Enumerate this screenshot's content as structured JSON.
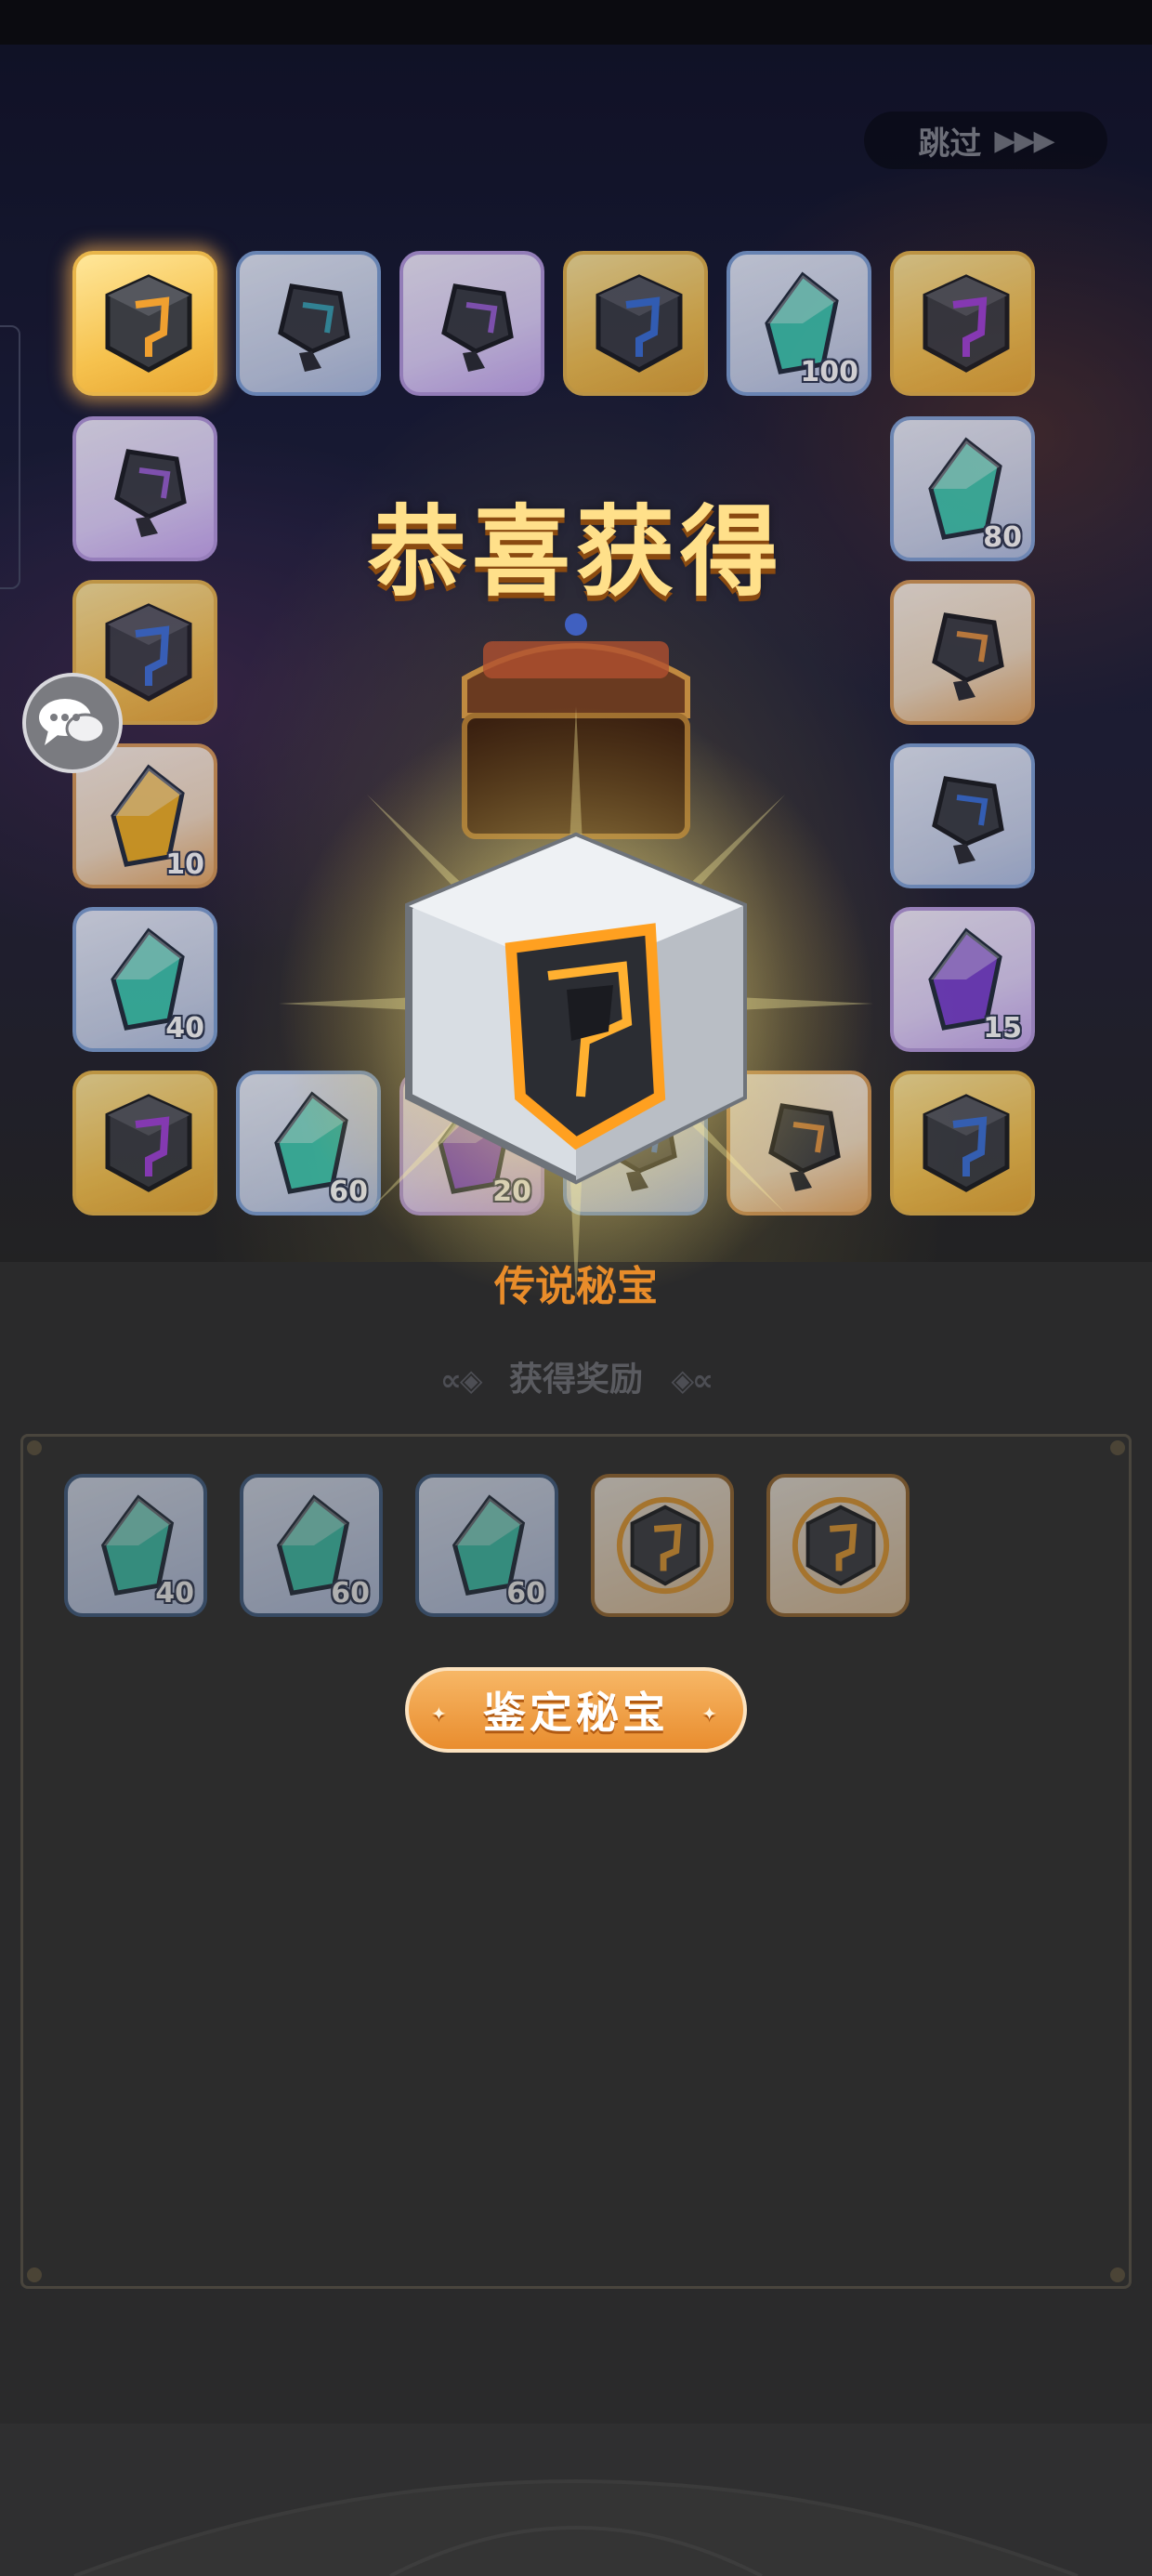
{
  "skip": {
    "label": "跳过",
    "arrows": "▶▶▶"
  },
  "headline": "恭喜获得",
  "obtained_item": {
    "name": "传说秘宝",
    "icon": "legendary-cube-icon"
  },
  "reward_header": {
    "label": "获得奖励",
    "deco_left": "∝◈",
    "deco_right": "◈∝"
  },
  "board": {
    "tiles": [
      {
        "kind": "cube",
        "rarity": "gold",
        "accent": "#f0a030",
        "qty": ""
      },
      {
        "kind": "cube-small",
        "rarity": "blue",
        "accent": "#3aa0b0",
        "qty": ""
      },
      {
        "kind": "cube-small",
        "rarity": "purple",
        "accent": "#9a60d0",
        "qty": ""
      },
      {
        "kind": "cube",
        "rarity": "gold",
        "accent": "#3a70d8",
        "qty": ""
      },
      {
        "kind": "crystal",
        "rarity": "blue",
        "accent": "#3cc8b0",
        "qty": "100"
      },
      {
        "kind": "cube",
        "rarity": "gold",
        "accent": "#a040d8",
        "qty": ""
      },
      {
        "kind": "cube-small",
        "rarity": "purple",
        "accent": "#9a60d0",
        "qty": ""
      },
      {
        "kind": "crystal",
        "rarity": "blue",
        "accent": "#3cc8b0",
        "qty": "80"
      },
      {
        "kind": "cube",
        "rarity": "gold",
        "accent": "#3a70d8",
        "qty": ""
      },
      {
        "kind": "cube-small",
        "rarity": "orange",
        "accent": "#e09040",
        "qty": ""
      },
      {
        "kind": "crystal",
        "rarity": "orange",
        "accent": "#f0b020",
        "qty": "10"
      },
      {
        "kind": "cube-small",
        "rarity": "blue",
        "accent": "#3a70d8",
        "qty": ""
      },
      {
        "kind": "crystal",
        "rarity": "blue",
        "accent": "#3cc8b0",
        "qty": "40"
      },
      {
        "kind": "crystal",
        "rarity": "purple",
        "accent": "#7a40d0",
        "qty": "15"
      },
      {
        "kind": "cube",
        "rarity": "gold",
        "accent": "#a040d8",
        "qty": ""
      },
      {
        "kind": "crystal",
        "rarity": "blue",
        "accent": "#3cc8b0",
        "qty": "60"
      },
      {
        "kind": "crystal",
        "rarity": "purple",
        "accent": "#7a40d0",
        "qty": "20"
      },
      {
        "kind": "cube-small",
        "rarity": "blue",
        "accent": "#3a70d8",
        "qty": ""
      },
      {
        "kind": "cube-small",
        "rarity": "orange",
        "accent": "#e09040",
        "qty": ""
      },
      {
        "kind": "cube",
        "rarity": "gold",
        "accent": "#3a70d8",
        "qty": ""
      }
    ]
  },
  "rewards": [
    {
      "kind": "crystal",
      "rarity": "blue",
      "accent": "#3cc8b0",
      "qty": "40"
    },
    {
      "kind": "crystal",
      "rarity": "blue",
      "accent": "#3cc8b0",
      "qty": "60"
    },
    {
      "kind": "crystal",
      "rarity": "blue",
      "accent": "#3cc8b0",
      "qty": "60"
    },
    {
      "kind": "cube-ring",
      "rarity": "orange",
      "accent": "#f0a030",
      "qty": ""
    },
    {
      "kind": "cube-ring",
      "rarity": "orange",
      "accent": "#f0a030",
      "qty": ""
    }
  ],
  "identify_button": {
    "label": "鉴定秘宝"
  },
  "chat": {
    "icon": "chat-bubbles-icon"
  }
}
